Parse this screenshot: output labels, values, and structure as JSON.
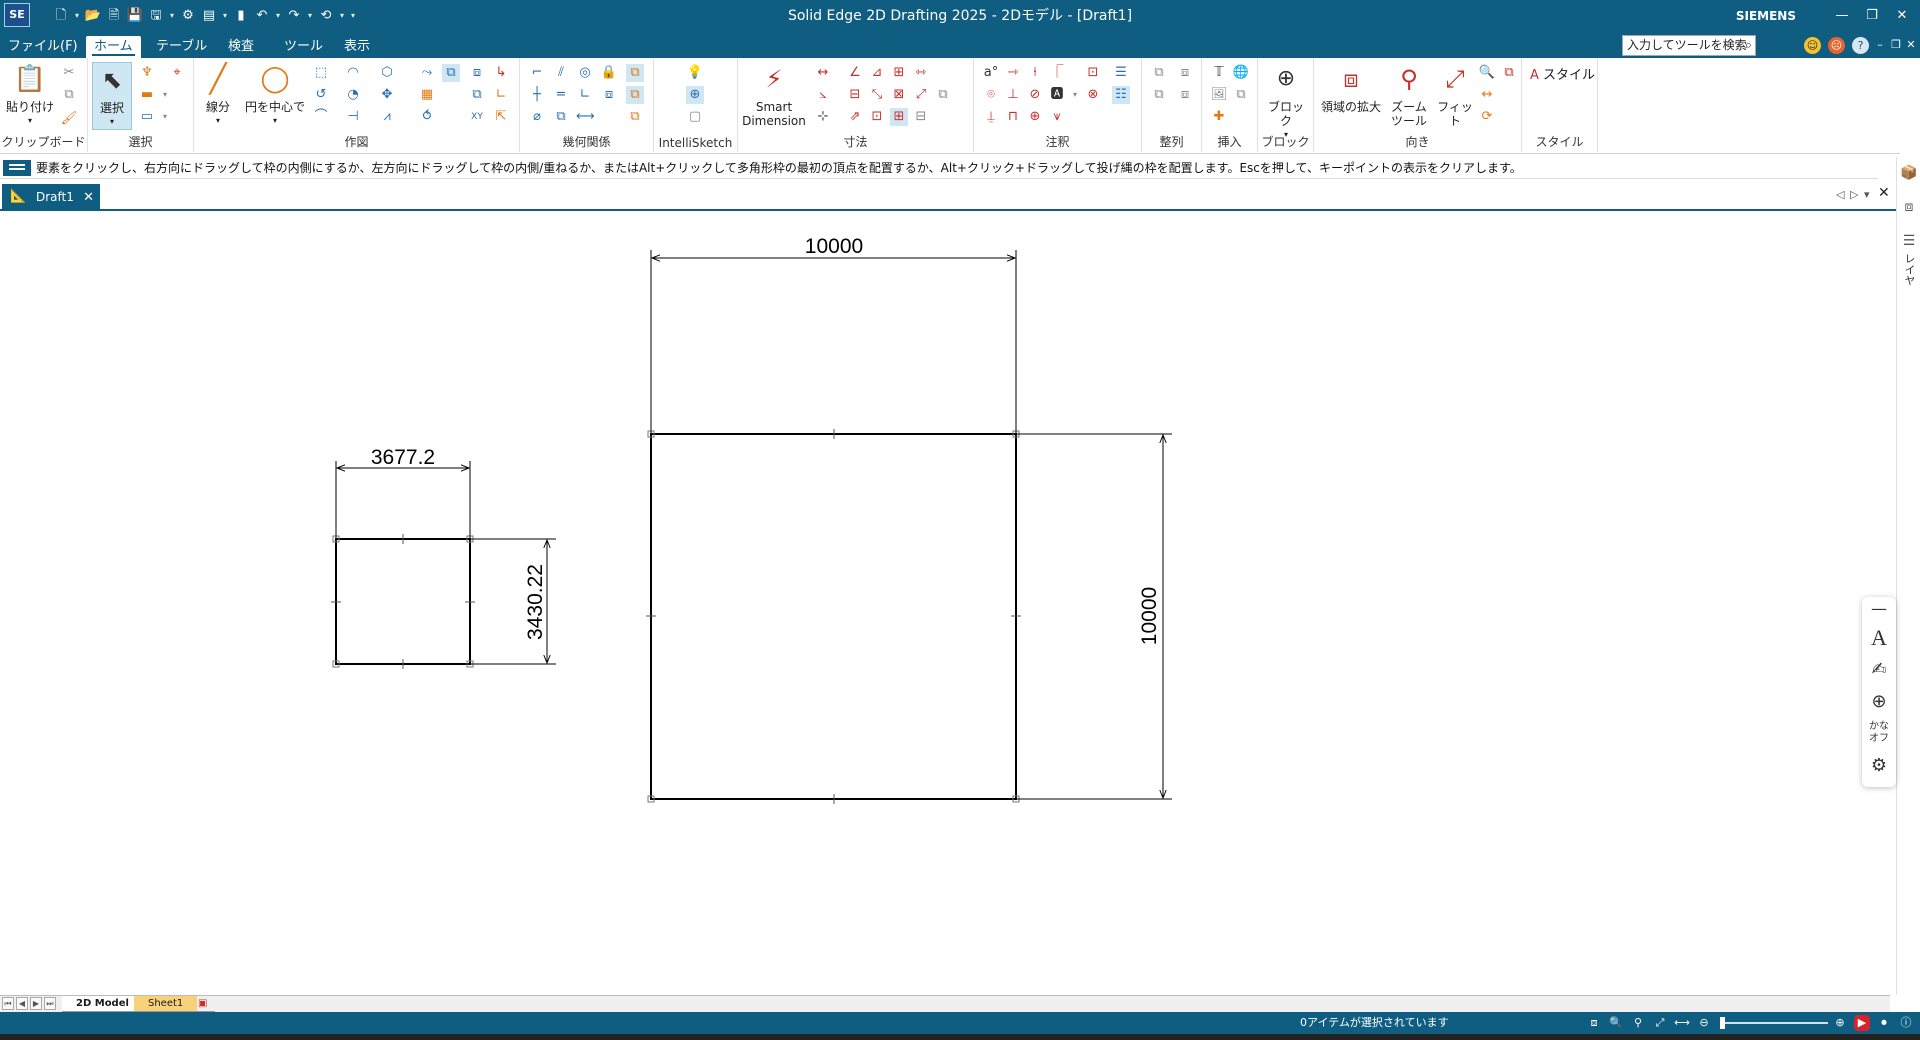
{
  "app": {
    "logo": "SE",
    "title": "Solid Edge 2D Drafting 2025 - 2Dモデル - [Draft1]",
    "brand": "SIEMENS"
  },
  "menu": {
    "tabs": [
      "ファイル(F)",
      "ホーム",
      "テーブル",
      "検査",
      "ツール",
      "表示"
    ],
    "active": "ホーム",
    "search_text": "入力してツールを検索"
  },
  "ribbon": {
    "groups": {
      "clipboard": "クリップボード",
      "select": "選択",
      "draw": "作図",
      "relations": "幾何関係",
      "intellisketch": "IntelliSketch",
      "dimension": "寸法",
      "annotation": "注釈",
      "arrange": "整列",
      "insert": "挿入",
      "block": "ブロック",
      "orient": "向き",
      "style": "スタイル"
    },
    "buttons": {
      "paste": "貼り付け",
      "select": "選択",
      "line": "線分",
      "circle": "円を中心で",
      "smart_dim_1": "Smart",
      "smart_dim_2": "Dimension",
      "block": "ブロック",
      "zoom_area": "領域の拡大",
      "zoom_tool_1": "ズーム",
      "zoom_tool_2": "ツール",
      "fit": "フィット",
      "style": "スタイル"
    }
  },
  "prompt": "要素をクリックし、右方向にドラッグして枠の内側にするか、左方向にドラッグして枠の内側/重ねるか、またはAlt+クリックして多角形枠の最初の頂点を配置するか、Alt+クリック+ドラッグして投げ縄の枠を配置します。Escを押して、キーポイントの表示をクリアします。",
  "document": {
    "tab": "Draft1"
  },
  "drawing": {
    "small_rect": {
      "width_dim": "3677.2",
      "height_dim": "3430.22"
    },
    "large_rect": {
      "width_dim": "10000",
      "height_dim": "10000"
    }
  },
  "side": {
    "layer": "レイヤ",
    "kana": "かな\nオフ"
  },
  "sheets": {
    "tabs": [
      "2D Model",
      "Sheet1"
    ],
    "active": "2D Model"
  },
  "status": {
    "text": "0アイテムが選択されています"
  }
}
